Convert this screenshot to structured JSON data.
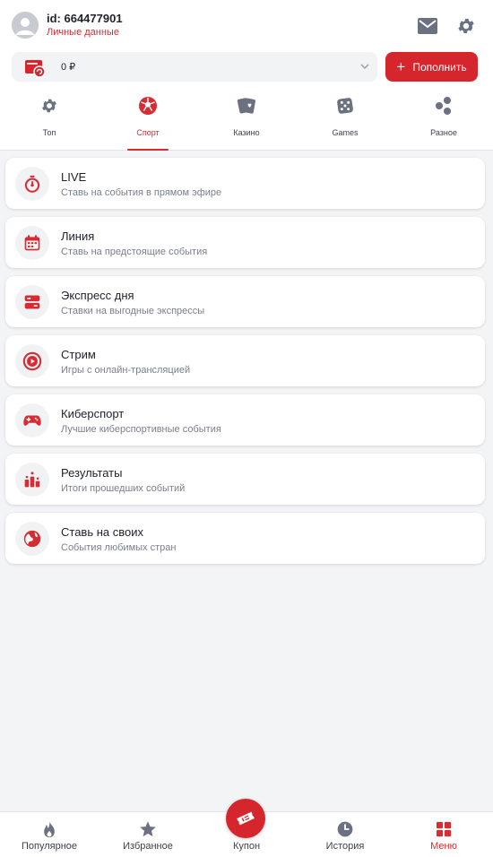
{
  "header": {
    "user_id": "id: 664477901",
    "personal_data_link": "Личные данные",
    "mail_icon": "mail-icon",
    "settings_icon": "gear-icon"
  },
  "balance": {
    "value": "0 ₽",
    "wallet_icon": "wallet-icon"
  },
  "deposit": {
    "plus": "+",
    "label": "Пополнить"
  },
  "category_tabs": [
    {
      "label": "Топ",
      "icon": "gear-icon",
      "active": false
    },
    {
      "label": "Спорт",
      "icon": "soccer-ball-icon",
      "active": true
    },
    {
      "label": "Казино",
      "icon": "cards-icon",
      "active": false
    },
    {
      "label": "Games",
      "icon": "dice-icon",
      "active": false
    },
    {
      "label": "Разное",
      "icon": "dots-icon",
      "active": false
    }
  ],
  "menu_items": [
    {
      "title": "LIVE",
      "subtitle": "Ставь на события в прямом эфире",
      "icon": "stopwatch-icon"
    },
    {
      "title": "Линия",
      "subtitle": "Ставь на предстоящие события",
      "icon": "calendar-icon"
    },
    {
      "title": "Экспресс дня",
      "subtitle": "Ставки на выгодные экспрессы",
      "icon": "express-icon"
    },
    {
      "title": "Стрим",
      "subtitle": "Игры с онлайн-трансляцией",
      "icon": "play-icon"
    },
    {
      "title": "Киберспорт",
      "subtitle": "Лучшие киберспортивные события",
      "icon": "gamepad-icon"
    },
    {
      "title": "Результаты",
      "subtitle": "Итоги прошедших событий",
      "icon": "podium-icon"
    },
    {
      "title": "Ставь на своих",
      "subtitle": "События любимых стран",
      "icon": "globe-icon"
    }
  ],
  "bottom_nav": [
    {
      "label": "Популярное",
      "icon": "fire-icon",
      "active": false
    },
    {
      "label": "Избранное",
      "icon": "star-icon",
      "active": false
    },
    {
      "label": "Купон",
      "icon": "ticket-icon",
      "active": false
    },
    {
      "label": "История",
      "icon": "clock-icon",
      "active": false
    },
    {
      "label": "Меню",
      "icon": "grid-icon",
      "active": true
    }
  ],
  "colors": {
    "accent": "#d52d33",
    "background": "#f3f4f6",
    "icon_gray": "#6b7180",
    "text": "#20242e",
    "subtext": "#7a7f8c"
  }
}
